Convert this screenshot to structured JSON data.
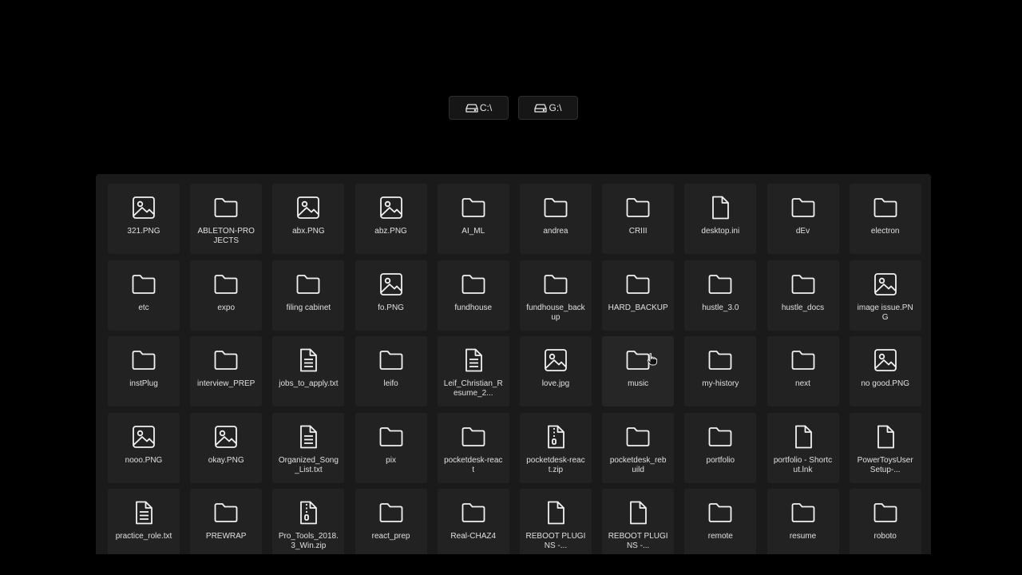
{
  "colors": {
    "background": "#000000",
    "panel": "#1a1a1a",
    "tile": "#222222",
    "text": "#e0e0e0"
  },
  "drives": [
    {
      "label": "C:\\",
      "icon": "drive-icon"
    },
    {
      "label": "G:\\",
      "icon": "drive-icon"
    }
  ],
  "items": [
    {
      "name": "321.PNG",
      "type": "image"
    },
    {
      "name": "ABLETON-PROJECTS",
      "type": "folder"
    },
    {
      "name": "abx.PNG",
      "type": "image"
    },
    {
      "name": "abz.PNG",
      "type": "image"
    },
    {
      "name": "AI_ML",
      "type": "folder"
    },
    {
      "name": "andrea",
      "type": "folder"
    },
    {
      "name": "CRIII",
      "type": "folder"
    },
    {
      "name": "desktop.ini",
      "type": "file"
    },
    {
      "name": "dEv",
      "type": "folder"
    },
    {
      "name": "electron",
      "type": "folder"
    },
    {
      "name": "etc",
      "type": "folder"
    },
    {
      "name": "expo",
      "type": "folder"
    },
    {
      "name": "filing cabinet",
      "type": "folder"
    },
    {
      "name": "fo.PNG",
      "type": "image"
    },
    {
      "name": "fundhouse",
      "type": "folder"
    },
    {
      "name": "fundhouse_backup",
      "type": "folder"
    },
    {
      "name": "HARD_BACKUP",
      "type": "folder"
    },
    {
      "name": "hustle_3.0",
      "type": "folder"
    },
    {
      "name": "hustle_docs",
      "type": "folder"
    },
    {
      "name": "image issue.PNG",
      "type": "image"
    },
    {
      "name": "instPlug",
      "type": "folder"
    },
    {
      "name": "interview_PREP",
      "type": "folder"
    },
    {
      "name": "jobs_to_apply.txt",
      "type": "text"
    },
    {
      "name": "leifo",
      "type": "folder"
    },
    {
      "name": "Leif_Christian_Resume_2...",
      "type": "text"
    },
    {
      "name": "love.jpg",
      "type": "image"
    },
    {
      "name": "music",
      "type": "folder"
    },
    {
      "name": "my-history",
      "type": "folder"
    },
    {
      "name": "next",
      "type": "folder"
    },
    {
      "name": "no good.PNG",
      "type": "image"
    },
    {
      "name": "nooo.PNG",
      "type": "image"
    },
    {
      "name": "okay.PNG",
      "type": "image"
    },
    {
      "name": "Organized_Song_List.txt",
      "type": "text"
    },
    {
      "name": "pix",
      "type": "folder"
    },
    {
      "name": "pocketdesk-react",
      "type": "folder"
    },
    {
      "name": "pocketdesk-react.zip",
      "type": "zip"
    },
    {
      "name": "pocketdesk_rebuild",
      "type": "folder"
    },
    {
      "name": "portfolio",
      "type": "folder"
    },
    {
      "name": "portfolio - Shortcut.lnk",
      "type": "file"
    },
    {
      "name": "PowerToysUserSetup-...",
      "type": "file"
    },
    {
      "name": "practice_role.txt",
      "type": "text"
    },
    {
      "name": "PREWRAP",
      "type": "folder"
    },
    {
      "name": "Pro_Tools_2018.3_Win.zip",
      "type": "zip"
    },
    {
      "name": "react_prep",
      "type": "folder"
    },
    {
      "name": "Real-CHAZ4",
      "type": "folder"
    },
    {
      "name": "REBOOT PLUGINS -...",
      "type": "file"
    },
    {
      "name": "REBOOT PLUGINS -...",
      "type": "file"
    },
    {
      "name": "remote",
      "type": "folder"
    },
    {
      "name": "resume",
      "type": "folder"
    },
    {
      "name": "roboto",
      "type": "folder"
    }
  ]
}
